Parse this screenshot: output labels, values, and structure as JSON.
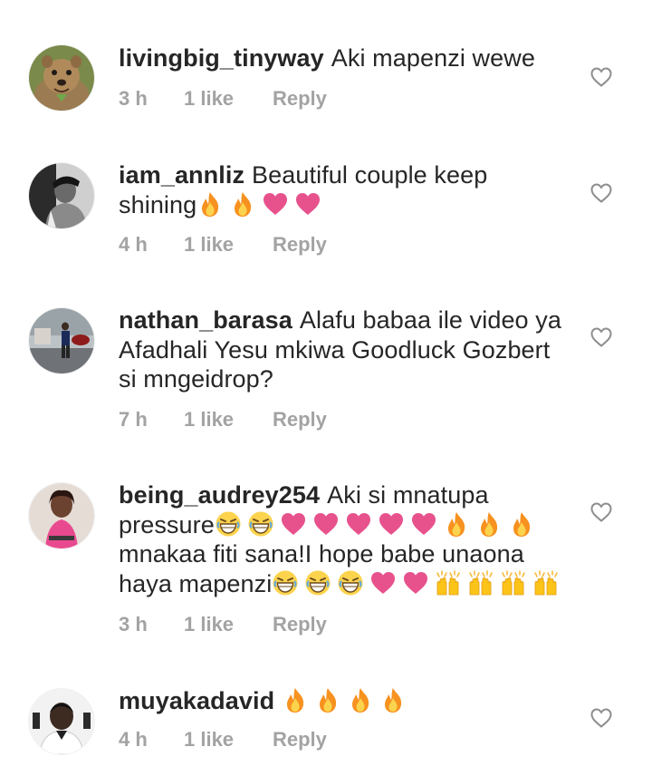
{
  "colors": {
    "text": "#262626",
    "meta": "#a3a3a3",
    "heart_outline": "#8e8e8e",
    "emoji_heart": "#e7528d",
    "fire_outer": "#f7911f",
    "fire_inner": "#fcd34d"
  },
  "comments": [
    {
      "username": "livingbig_tinyway",
      "text_parts": [
        "Aki mapenzi wewe"
      ],
      "time": "3 h",
      "likes": "1 like",
      "reply": "Reply",
      "avatar_icon": "quokka-avatar",
      "like_icon": "heart-outline-icon"
    },
    {
      "username": "iam_annliz",
      "text_parts": [
        "Beautiful couple keep shining"
      ],
      "emojis": [
        "fire",
        "fire",
        "heart",
        "heart"
      ],
      "time": "4 h",
      "likes": "1 like",
      "reply": "Reply",
      "avatar_icon": "bw-portrait-avatar",
      "like_icon": "heart-outline-icon"
    },
    {
      "username": "nathan_barasa",
      "text_parts": [
        "Alafu babaa ile video ya Afadhali Yesu mkiwa Goodluck Gozbert si mngeidrop?"
      ],
      "time": "7 h",
      "likes": "1 like",
      "reply": "Reply",
      "avatar_icon": "street-photo-avatar",
      "like_icon": "heart-outline-icon"
    },
    {
      "username": "being_audrey254",
      "text_parts": [
        "Aki si mnatupa pressure",
        "mnakaa fiti sana!I hope babe unaona haya mapenzi"
      ],
      "emojis_1": [
        "grin",
        "grin",
        "heart",
        "heart",
        "heart",
        "heart",
        "heart",
        "fire",
        "fire",
        "fire"
      ],
      "emojis_2": [
        "grin",
        "grin",
        "grin",
        "heart",
        "heart",
        "raised-hands",
        "raised-hands",
        "raised-hands",
        "raised-hands"
      ],
      "time": "3 h",
      "likes": "1 like",
      "reply": "Reply",
      "avatar_icon": "woman-pink-top-avatar",
      "like_icon": "heart-outline-icon"
    },
    {
      "username": "muyakadavid",
      "emojis": [
        "fire",
        "fire",
        "fire",
        "fire"
      ],
      "time": "4 h",
      "likes": "1 like",
      "reply": "Reply",
      "avatar_icon": "man-portrait-avatar",
      "like_icon": "heart-outline-icon"
    }
  ]
}
